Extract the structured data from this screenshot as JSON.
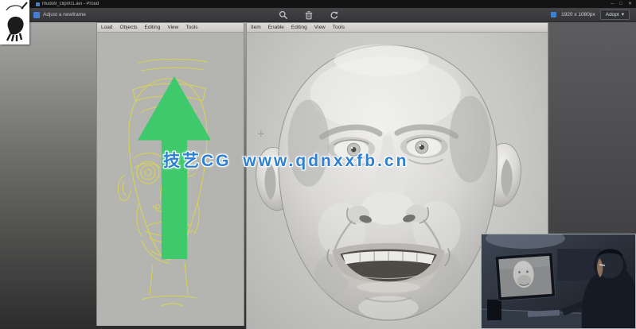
{
  "window": {
    "title": "mudo9_clip001.avi - Proud",
    "minimize_glyph": "─",
    "maximize_glyph": "□",
    "close_glyph": "✕"
  },
  "toolbar": {
    "file_label": "Adjust a newframe",
    "zoom_icon": "magnifier-icon",
    "delete_icon": "trash-icon",
    "undo_icon": "undo-arrow-icon",
    "resolution_label": "1920 x 1080px",
    "adopt_label": "Adopt",
    "adopt_caret": "▾"
  },
  "left_viewport": {
    "menu": [
      "Load",
      "Objects",
      "Editing",
      "View",
      "Tools"
    ]
  },
  "right_viewport": {
    "menu": [
      "Item",
      "Enable",
      "Editing",
      "View",
      "Tools"
    ]
  },
  "watermark": {
    "text": "技艺CG www.qdnxxfb.cn",
    "color": "#2e80d2"
  },
  "colors": {
    "titlebar": "#131313",
    "toolbar": "#3a3a3c",
    "viewport_menubar": "#d2d0cd",
    "sketch_background": "#b4b4b1",
    "model_background": "#c8c8c6",
    "sketch_stroke": "#d8d44c",
    "watermark_blue": "#2e80d2"
  }
}
